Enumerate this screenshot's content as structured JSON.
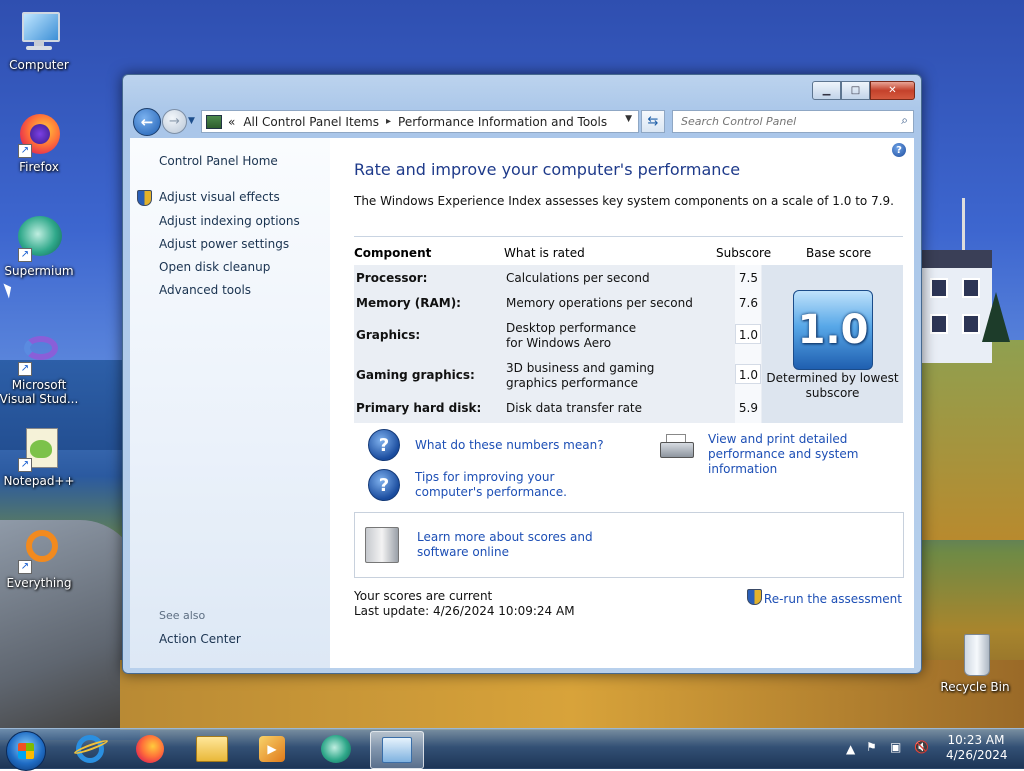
{
  "desktop": {
    "icons": [
      {
        "label": "Computer"
      },
      {
        "label": "Firefox"
      },
      {
        "label": "Supermium"
      },
      {
        "label": "Microsoft Visual Stud..."
      },
      {
        "label": "Notepad++"
      },
      {
        "label": "Everything"
      },
      {
        "label": "Recycle Bin"
      }
    ]
  },
  "window": {
    "buttons": {
      "minimize": "▁",
      "maximize": "□",
      "close": "✕"
    },
    "address": {
      "chevron": "«",
      "crumbs": [
        "All Control Panel Items",
        "Performance Information and Tools"
      ],
      "separator": "▸"
    },
    "search_placeholder": "Search Control Panel",
    "sidebar": {
      "home": "Control Panel Home",
      "links": [
        "Adjust visual effects",
        "Adjust indexing options",
        "Adjust power settings",
        "Open disk cleanup",
        "Advanced tools"
      ],
      "see_also": "See also",
      "action_center": "Action Center"
    },
    "content": {
      "title": "Rate and improve your computer's performance",
      "description": "The Windows Experience Index assesses key system components on a scale of 1.0 to 7.9.",
      "table": {
        "headers": {
          "component": "Component",
          "what": "What is rated",
          "subscore": "Subscore",
          "base": "Base score"
        },
        "rows": [
          {
            "component": "Processor:",
            "what": "Calculations per second",
            "subscore": "7.5"
          },
          {
            "component": "Memory (RAM):",
            "what": "Memory operations per second",
            "subscore": "7.6"
          },
          {
            "component": "Graphics:",
            "what": "Desktop performance for Windows Aero",
            "subscore": "1.0"
          },
          {
            "component": "Gaming graphics:",
            "what": "3D business and gaming graphics performance",
            "subscore": "1.0"
          },
          {
            "component": "Primary hard disk:",
            "what": "Disk data transfer rate",
            "subscore": "5.9"
          }
        ],
        "base_score": "1.0",
        "base_note": "Determined by lowest subscore"
      },
      "links": {
        "numbers": "What do these numbers mean?",
        "tips": "Tips for improving your computer's performance.",
        "print": "View and print detailed performance and system information",
        "learn": "Learn more about scores and software online"
      },
      "status": {
        "current": "Your scores are current",
        "last_update": "Last update: 4/26/2024 10:09:24 AM"
      },
      "rerun": "Re-run the assessment"
    }
  },
  "taskbar": {
    "clock_time": "10:23 AM",
    "clock_date": "4/26/2024"
  }
}
